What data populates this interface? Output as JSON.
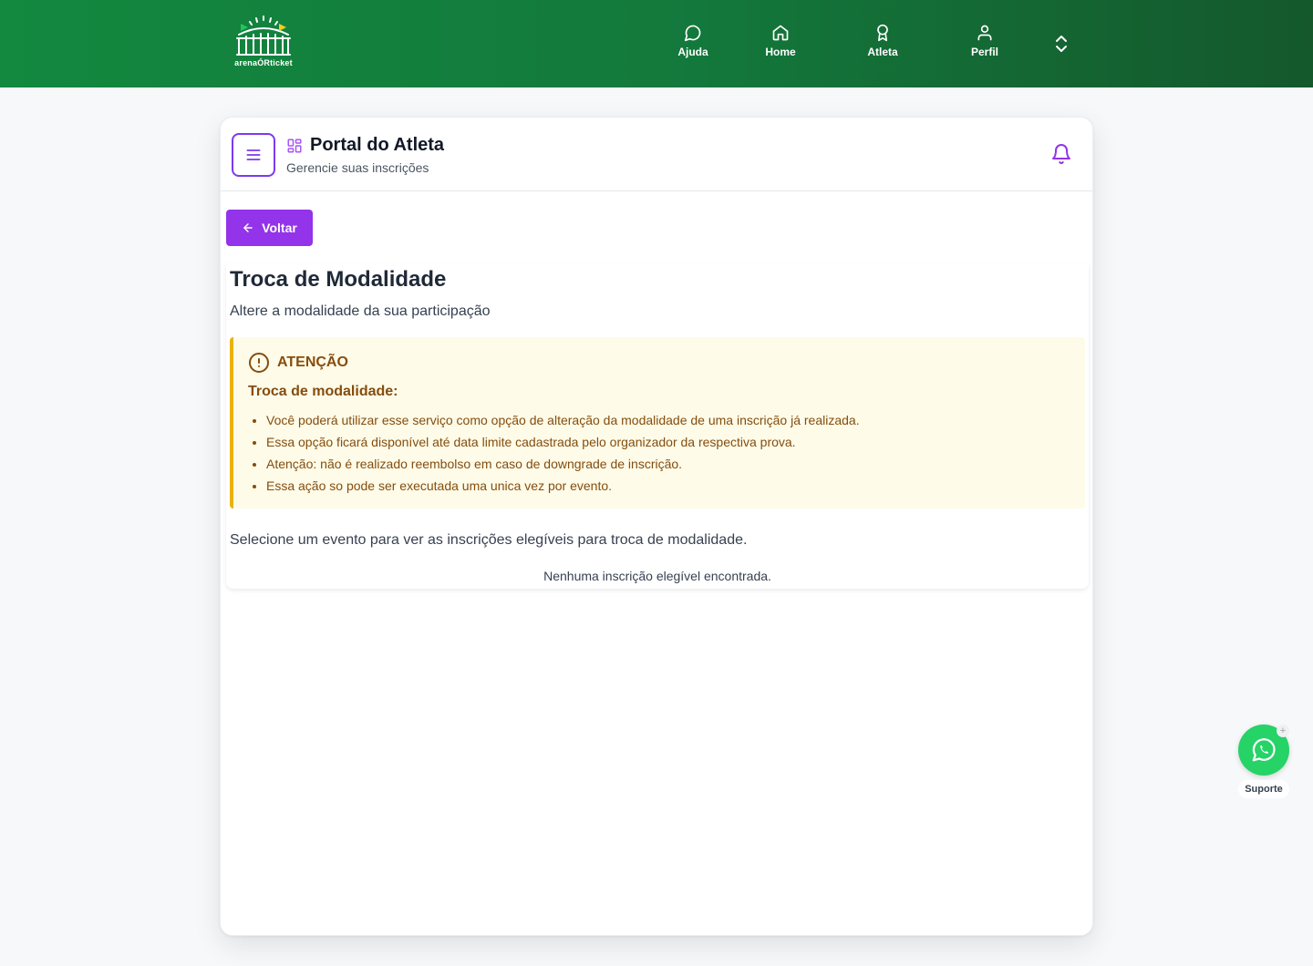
{
  "brand": {
    "logo_text": "arenaÓRticket"
  },
  "nav": [
    {
      "label": "Ajuda",
      "icon": "chat-icon"
    },
    {
      "label": "Home",
      "icon": "home-icon"
    },
    {
      "label": "Atleta",
      "icon": "award-icon"
    },
    {
      "label": "Perfil",
      "icon": "user-icon"
    }
  ],
  "portal": {
    "title": "Portal do Atleta",
    "subtitle": "Gerencie suas inscrições"
  },
  "back_label": "Voltar",
  "page": {
    "title": "Troca de Modalidade",
    "subtitle": "Altere a modalidade da sua participação"
  },
  "alert": {
    "title": "ATENÇÃO",
    "subtitle": "Troca de modalidade:",
    "items": [
      "Você poderá utilizar esse serviço como opção de alteração da modalidade de uma inscrição já realizada.",
      "Essa opção ficará disponível até data limite cadastrada pelo organizador da respectiva prova.",
      "Atenção: não é realizado reembolso em caso de downgrade de inscrição.",
      "Essa ação so pode ser executada uma unica vez por evento."
    ]
  },
  "select_message": "Selecione um evento para ver as inscrições elegíveis para troca de modalidade.",
  "empty_message": "Nenhuma inscrição elegível encontrada.",
  "support": {
    "label": "Suporte"
  },
  "colors": {
    "header_green": "#13883f",
    "accent_purple": "#9333ea",
    "alert_bg": "#fefbe8",
    "alert_border": "#eab308",
    "alert_text": "#854d0e",
    "whatsapp": "#25d366"
  }
}
